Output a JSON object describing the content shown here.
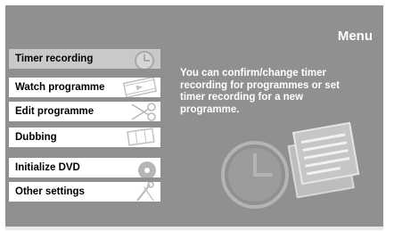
{
  "menu": {
    "title": "Menu",
    "items": [
      {
        "label": "Timer recording",
        "icon": "clock-icon",
        "selected": true
      },
      {
        "label": "Watch programme",
        "icon": "film-play-icon",
        "selected": false
      },
      {
        "label": "Edit programme",
        "icon": "scissors-icon",
        "selected": false
      },
      {
        "label": "Dubbing",
        "icon": "film-strip-icon",
        "selected": false
      },
      {
        "label": "Initialize DVD",
        "icon": "disc-icon",
        "selected": false
      },
      {
        "label": "Other settings",
        "icon": "wrench-screwdriver-icon",
        "selected": false
      }
    ]
  },
  "description": "You can confirm/change timer recording for programmes or set timer recording for a new programme.",
  "colors": {
    "background": "#909090",
    "selected_item": "#c9c9c9",
    "item": "#ffffff",
    "text_light": "#ffffff"
  }
}
